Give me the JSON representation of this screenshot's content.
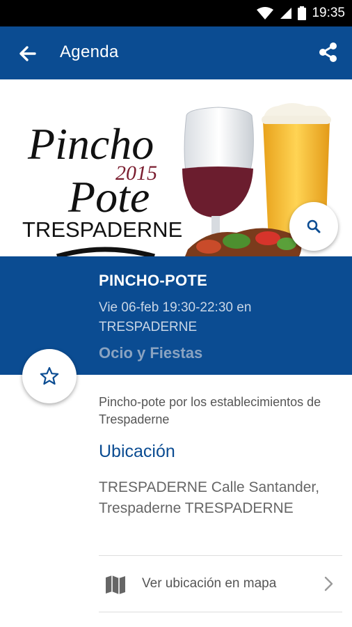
{
  "status_bar": {
    "time": "19:35"
  },
  "app_bar": {
    "title": "Agenda"
  },
  "hero": {
    "line1": "Pincho",
    "year": "2015",
    "line2": "Pote",
    "town": "TRESPADERNE"
  },
  "event": {
    "title": "PINCHO-POTE",
    "date_line1": "Vie 06-feb 19:30-22:30 en",
    "date_line2": "TRESPADERNE",
    "category": "Ocio y Fiestas",
    "description": "Pincho-pote por los establecimientos de Trespaderne"
  },
  "location": {
    "section_title": "Ubicación",
    "address": "TRESPADERNE Calle Santander, Trespaderne TRESPADERNE",
    "map_link_label": "Ver ubicación en mapa"
  },
  "colors": {
    "primary": "#0b4c92",
    "wine": "#6b1d2e",
    "beer": "#f2b632"
  },
  "icons": [
    "back-arrow-icon",
    "share-icon",
    "search-icon",
    "star-outline-icon",
    "map-icon",
    "chevron-right-icon",
    "wifi-icon",
    "signal-icon",
    "battery-icon"
  ]
}
